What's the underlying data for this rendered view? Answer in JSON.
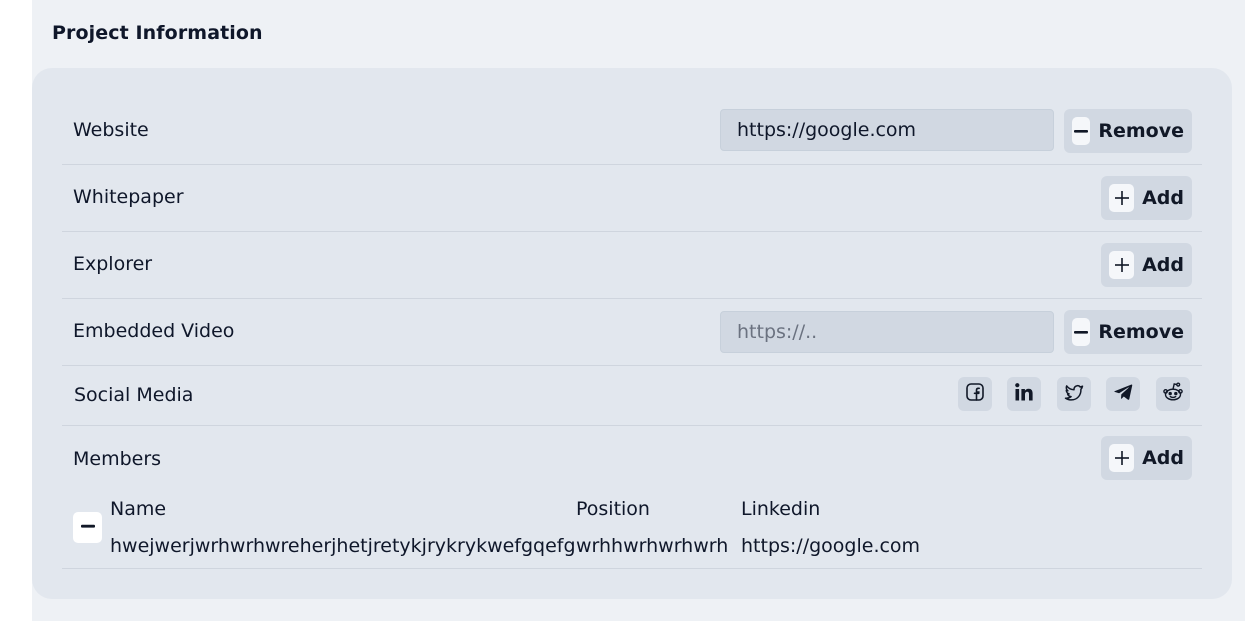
{
  "section": {
    "title": "Project Information"
  },
  "rows": {
    "website": {
      "label": "Website",
      "value": "https://google.com",
      "placeholder": "https://..",
      "button": "Remove"
    },
    "whitepaper": {
      "label": "Whitepaper",
      "button": "Add"
    },
    "explorer": {
      "label": "Explorer",
      "button": "Add"
    },
    "embedded_video": {
      "label": "Embedded Video",
      "value": "",
      "placeholder": "https://..",
      "button": "Remove"
    },
    "social_media": {
      "label": "Social Media",
      "icons": [
        "facebook-icon",
        "linkedin-icon",
        "twitter-icon",
        "telegram-icon",
        "reddit-icon"
      ]
    },
    "members": {
      "label": "Members",
      "button": "Add",
      "columns": {
        "name": "Name",
        "position": "Position",
        "linkedin": "Linkedin"
      },
      "entries": [
        {
          "name": "hwejwerjwrhwrhwreherjhetjretykjrykrykwefgqefg",
          "position": "wrhhwrhwrhwrh",
          "linkedin": "https://google.com"
        }
      ]
    }
  },
  "colors": {
    "page_bg": "#eef1f5",
    "card_bg": "#e2e7ee",
    "button_bg": "#d1d8e2",
    "input_bg": "#d1d8e2"
  }
}
